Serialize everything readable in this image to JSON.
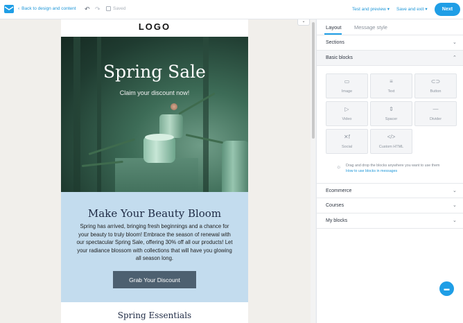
{
  "topbar": {
    "back_label": "Back to design and content",
    "saved_label": "Saved",
    "test_preview_label": "Test and preview",
    "save_exit_label": "Save and exit",
    "next_label": "Next"
  },
  "email": {
    "logo": "LOGO",
    "hero_title": "Spring Sale",
    "hero_subtitle": "Claim your discount now!",
    "promo_title": "Make Your Beauty Bloom",
    "promo_body": "Spring has arrived, bringing fresh beginnings and a chance for your beauty to truly bloom! Embrace the season of renewal with our spectacular Spring Sale, offering 30% off all our products! Let your radiance blossom with collections that will have you glowing all season long.",
    "cta_label": "Grab Your Discount",
    "next_section_title": "Spring Essentials",
    "promo_bg": "#c3dcee",
    "cta_bg": "#4d6070"
  },
  "panel": {
    "tabs": [
      {
        "label": "Layout",
        "active": true
      },
      {
        "label": "Message style",
        "active": false
      }
    ],
    "sections": {
      "sections": "Sections",
      "basic_blocks": "Basic blocks",
      "ecommerce": "Ecommerce",
      "courses": "Courses",
      "my_blocks": "My blocks"
    },
    "blocks": [
      {
        "label": "Image",
        "icon": "image-icon"
      },
      {
        "label": "Text",
        "icon": "text-icon"
      },
      {
        "label": "Button",
        "icon": "button-icon"
      },
      {
        "label": "Video",
        "icon": "video-icon"
      },
      {
        "label": "Spacer",
        "icon": "spacer-icon"
      },
      {
        "label": "Divider",
        "icon": "divider-icon"
      },
      {
        "label": "Social",
        "icon": "social-icon"
      },
      {
        "label": "Custom HTML",
        "icon": "code-icon"
      }
    ],
    "hint_text": "Drag and drop the blocks anywhere you want to use them",
    "hint_link": "How to use blocks in messages"
  },
  "colors": {
    "accent": "#1f9ee6",
    "link": "#1f97d8"
  }
}
